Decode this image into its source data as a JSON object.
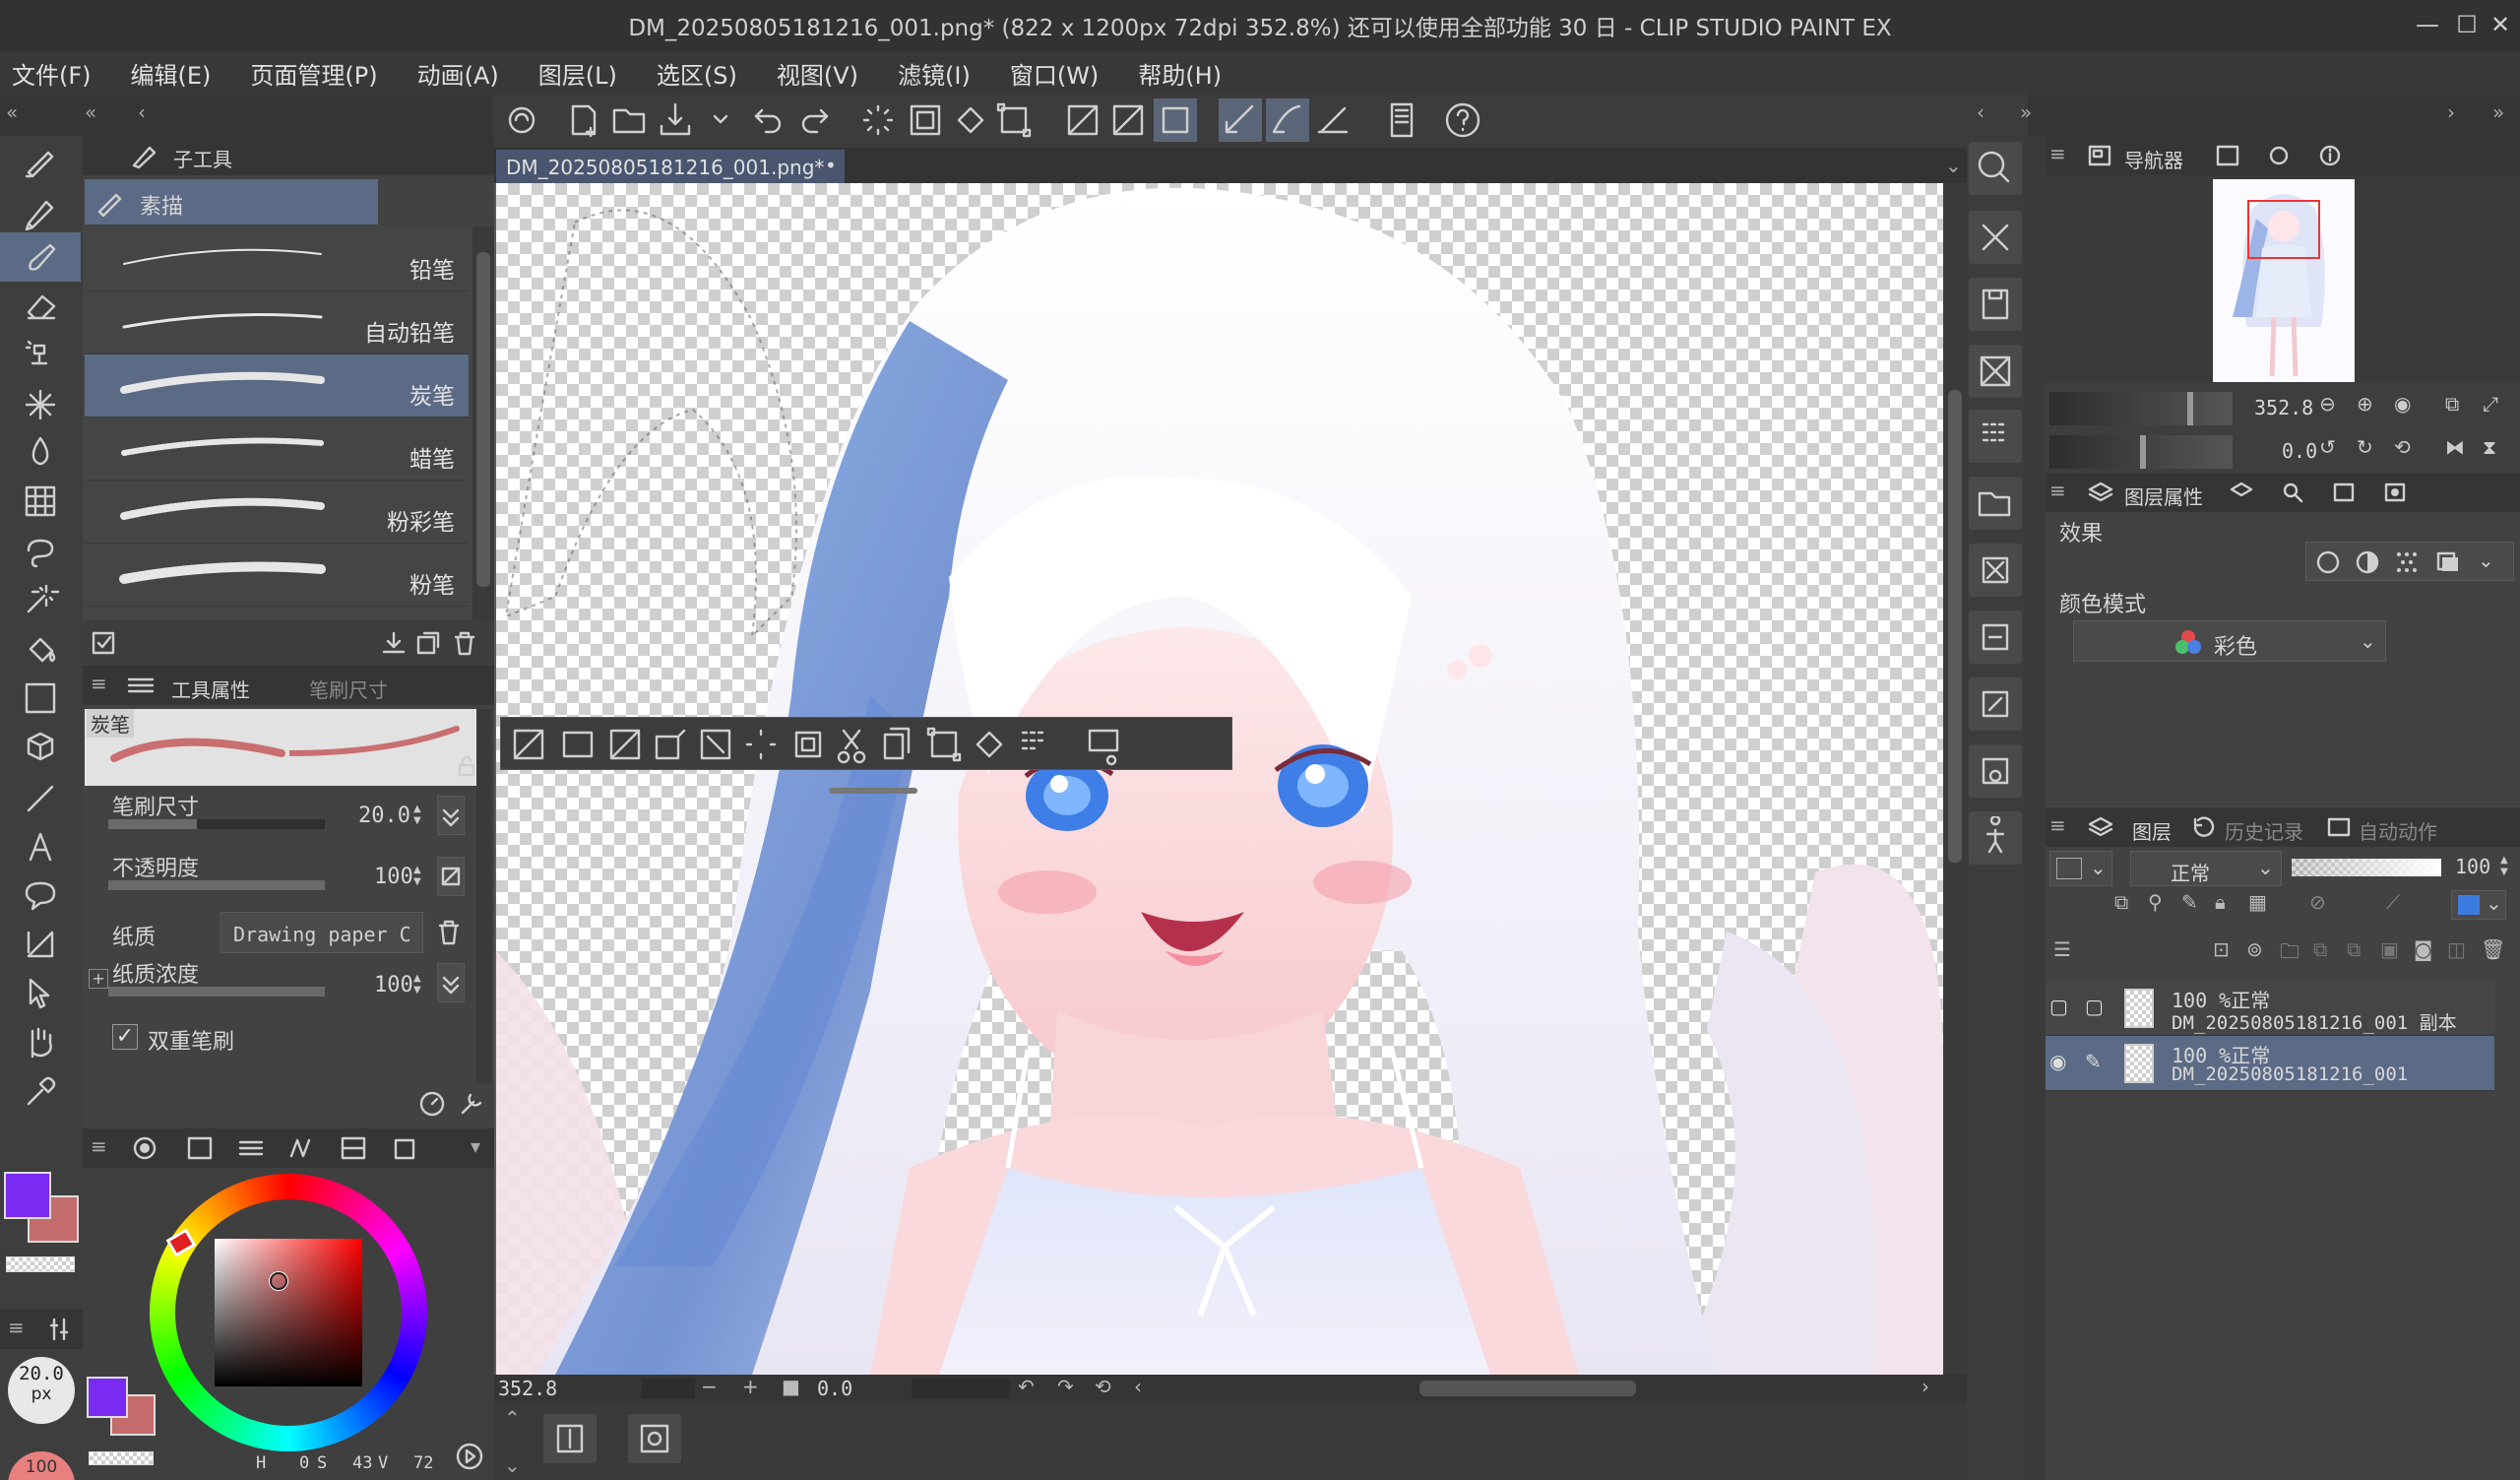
{
  "window": {
    "title": "DM_20250805181216_001.png* (822 x 1200px 72dpi 352.8%)  还可以使用全部功能 30 日 - CLIP STUDIO PAINT EX",
    "controls": [
      "minimize",
      "maximize",
      "close"
    ]
  },
  "menu": [
    "文件(F)",
    "编辑(E)",
    "页面管理(P)",
    "动画(A)",
    "图层(L)",
    "选区(S)",
    "视图(V)",
    "滤镜(I)",
    "窗口(W)",
    "帮助(H)"
  ],
  "subtool": {
    "tab_label": "子工具",
    "group_label": "素描",
    "brushes": [
      {
        "name": "铅笔",
        "selected": false
      },
      {
        "name": "自动铅笔",
        "selected": false
      },
      {
        "name": "炭笔",
        "selected": true
      },
      {
        "name": "蜡笔",
        "selected": false
      },
      {
        "name": "粉彩笔",
        "selected": false
      },
      {
        "name": "粉笔",
        "selected": false
      }
    ]
  },
  "tool_property": {
    "tab_label": "工具属性",
    "tab2_label": "笔刷尺寸",
    "preview_label": "炭笔",
    "brush_size_label": "笔刷尺寸",
    "brush_size_value": "20.0",
    "opacity_label": "不透明度",
    "opacity_value": "100",
    "paper_label": "纸质",
    "paper_value": "Drawing paper C",
    "paper_density_label": "纸质浓度",
    "paper_density_value": "100",
    "dual_brush_label": "双重笔刷",
    "dual_brush_checked": true
  },
  "color": {
    "main": "#7a2bf2",
    "sub": "#c46b6b",
    "brush_size_display": "20.0",
    "brush_size_unit": "px",
    "opacity_badge": "100",
    "hsv": {
      "h_label": "H",
      "h": "0",
      "s_label": "S",
      "s": "43",
      "v_label": "V",
      "v": "72"
    }
  },
  "canvas": {
    "tab_label": "DM_20250805181216_001.png*",
    "zoom": "352.8",
    "rotation": "0.0"
  },
  "navigator": {
    "tab_label": "导航器",
    "zoom": "352.8",
    "rotation": "0.0"
  },
  "layer_property": {
    "tab_label": "图层属性",
    "effect_label": "效果",
    "color_mode_label": "颜色模式",
    "color_mode_value": "彩色"
  },
  "layers_panel": {
    "tab_label": "图层",
    "tab2_label": "历史记录",
    "tab3_label": "自动动作",
    "blend_mode": "正常",
    "opacity": "100",
    "layers": [
      {
        "info": "100 %正常",
        "name": "DM_20250805181216_001 副本",
        "visible": false,
        "selected": false
      },
      {
        "info": "100 %正常",
        "name": "DM_20250805181216_001",
        "visible": true,
        "selected": true
      }
    ]
  },
  "icons": {
    "left_tools": [
      "pen-icon",
      "pencil-icon",
      "brush-icon",
      "eraser-icon",
      "airbrush-icon",
      "decoration-icon",
      "blend-icon",
      "grid-icon",
      "lasso-icon",
      "magic-wand-icon",
      "fill-icon",
      "gradient-icon",
      "3d-icon",
      "line-icon",
      "text-icon",
      "balloon-icon",
      "frame-icon",
      "operation-icon",
      "hand-icon",
      "eyedropper-icon"
    ]
  }
}
